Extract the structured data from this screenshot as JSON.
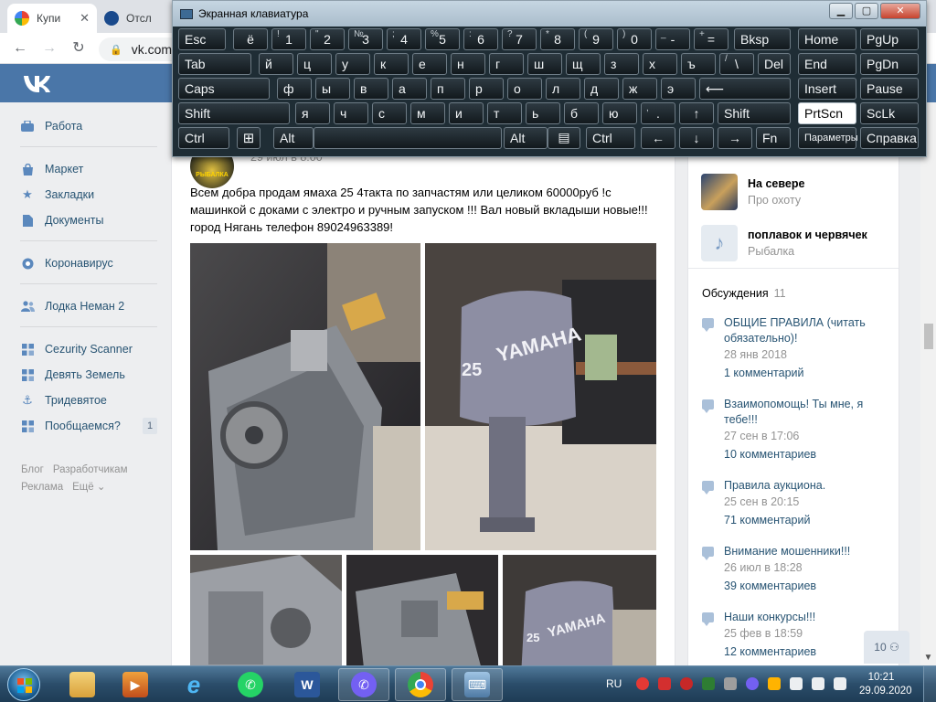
{
  "browser": {
    "tabs": [
      {
        "title": "Купи",
        "favicon_color": "#4285f4"
      },
      {
        "title": "Отсл",
        "favicon_color": "#1a4a8c"
      }
    ],
    "url": "vk.com"
  },
  "osk": {
    "title": "Экранная клавиатура",
    "keys": {
      "esc": "Esc",
      "bksp": "Bksp",
      "home": "Home",
      "pgup": "PgUp",
      "tab": "Tab",
      "del": "Del",
      "end": "End",
      "pgdn": "PgDn",
      "caps": "Caps",
      "enter": "⟵",
      "insert": "Insert",
      "pause": "Pause",
      "shift": "Shift",
      "shift_r": "Shift",
      "prtscn": "PrtScn",
      "sclk": "ScLk",
      "ctrl": "Ctrl",
      "alt": "Alt",
      "alt_r": "Alt",
      "ctrl_r": "Ctrl",
      "fn": "Fn",
      "options": "Параметры",
      "help": "Справка",
      "left": "←",
      "down": "↓",
      "right": "→",
      "up": "↑",
      "row1": [
        [
          "ё",
          ""
        ],
        [
          "1",
          "!"
        ],
        [
          "2",
          "\""
        ],
        [
          "3",
          "№"
        ],
        [
          "4",
          ";"
        ],
        [
          "5",
          "%"
        ],
        [
          "6",
          ":"
        ],
        [
          "7",
          "?"
        ],
        [
          "8",
          "*"
        ],
        [
          "9",
          "("
        ],
        [
          "0",
          ")"
        ],
        [
          "-",
          "_"
        ],
        [
          "=",
          "+"
        ]
      ],
      "row2": [
        "й",
        "ц",
        "у",
        "к",
        "е",
        "н",
        "г",
        "ш",
        "щ",
        "з",
        "х",
        "ъ"
      ],
      "row2_extra": [
        "\\",
        "/"
      ],
      "row3": [
        "ф",
        "ы",
        "в",
        "а",
        "п",
        "р",
        "о",
        "л",
        "д",
        "ж",
        "э"
      ],
      "row4": [
        "я",
        "ч",
        "с",
        "м",
        "и",
        "т",
        "ь",
        "б",
        "ю"
      ],
      "row4_extra": [
        ".",
        ","
      ]
    }
  },
  "vk": {
    "menu": [
      {
        "label": "Работа",
        "icon": "briefcase-icon"
      },
      {
        "label": "Маркет",
        "icon": "bag-icon"
      },
      {
        "label": "Закладки",
        "icon": "star-icon"
      },
      {
        "label": "Документы",
        "icon": "document-icon"
      },
      {
        "label": "Коронавирус",
        "icon": "globe-icon"
      },
      {
        "label": "Лодка Неман 2",
        "icon": "people-icon"
      },
      {
        "label": "Cezurity Scanner",
        "icon": "grid-icon"
      },
      {
        "label": "Девять Земель",
        "icon": "grid-icon"
      },
      {
        "label": "Тридевятое",
        "icon": "anchor-icon"
      },
      {
        "label": "Пообщаемся?",
        "icon": "grid-icon",
        "count": "1"
      }
    ],
    "footer": {
      "blog": "Блог",
      "dev": "Разработчикам",
      "ads": "Реклама",
      "more": "Ещё ⌄"
    },
    "post": {
      "avatar_text": "РЫБАЛКА",
      "date": "29 июл в 8:00",
      "text": "Всем добра продам ямаха 25 4такта по запчастям или целиком 60000руб !с машинкой с доками с электро и ручным запуском !!! Вал новый вкладыши новые!!!город Нягань телефон 89024963389!"
    },
    "groups": [
      {
        "name": "На севере",
        "sub": "Про охоту"
      },
      {
        "name": "поплавок и червячек",
        "sub": "Рыбалка"
      }
    ],
    "discussions": {
      "title": "Обсуждения",
      "count": "11",
      "items": [
        {
          "title": "ОБЩИЕ ПРАВИЛА (читать обязательно)!",
          "date": "28 янв 2018",
          "comments": "1 комментарий"
        },
        {
          "title": "Взаимопомощь! Ты мне, я тебе!!!",
          "date": "27 сен в 17:06",
          "comments": "10 комментариев"
        },
        {
          "title": "Правила аукциона.",
          "date": "25 сен в 20:15",
          "comments": "71 комментарий"
        },
        {
          "title": "Внимание мошенники!!!",
          "date": "26 июл в 18:28",
          "comments": "39 комментариев"
        },
        {
          "title": "Наши конкурсы!!!",
          "date": "25 фев в 18:59",
          "comments": "12 комментариев"
        }
      ]
    },
    "chat_count": "10 ⚇"
  },
  "taskbar": {
    "lang": "RU",
    "time": "10:21",
    "date": "29.09.2020"
  }
}
